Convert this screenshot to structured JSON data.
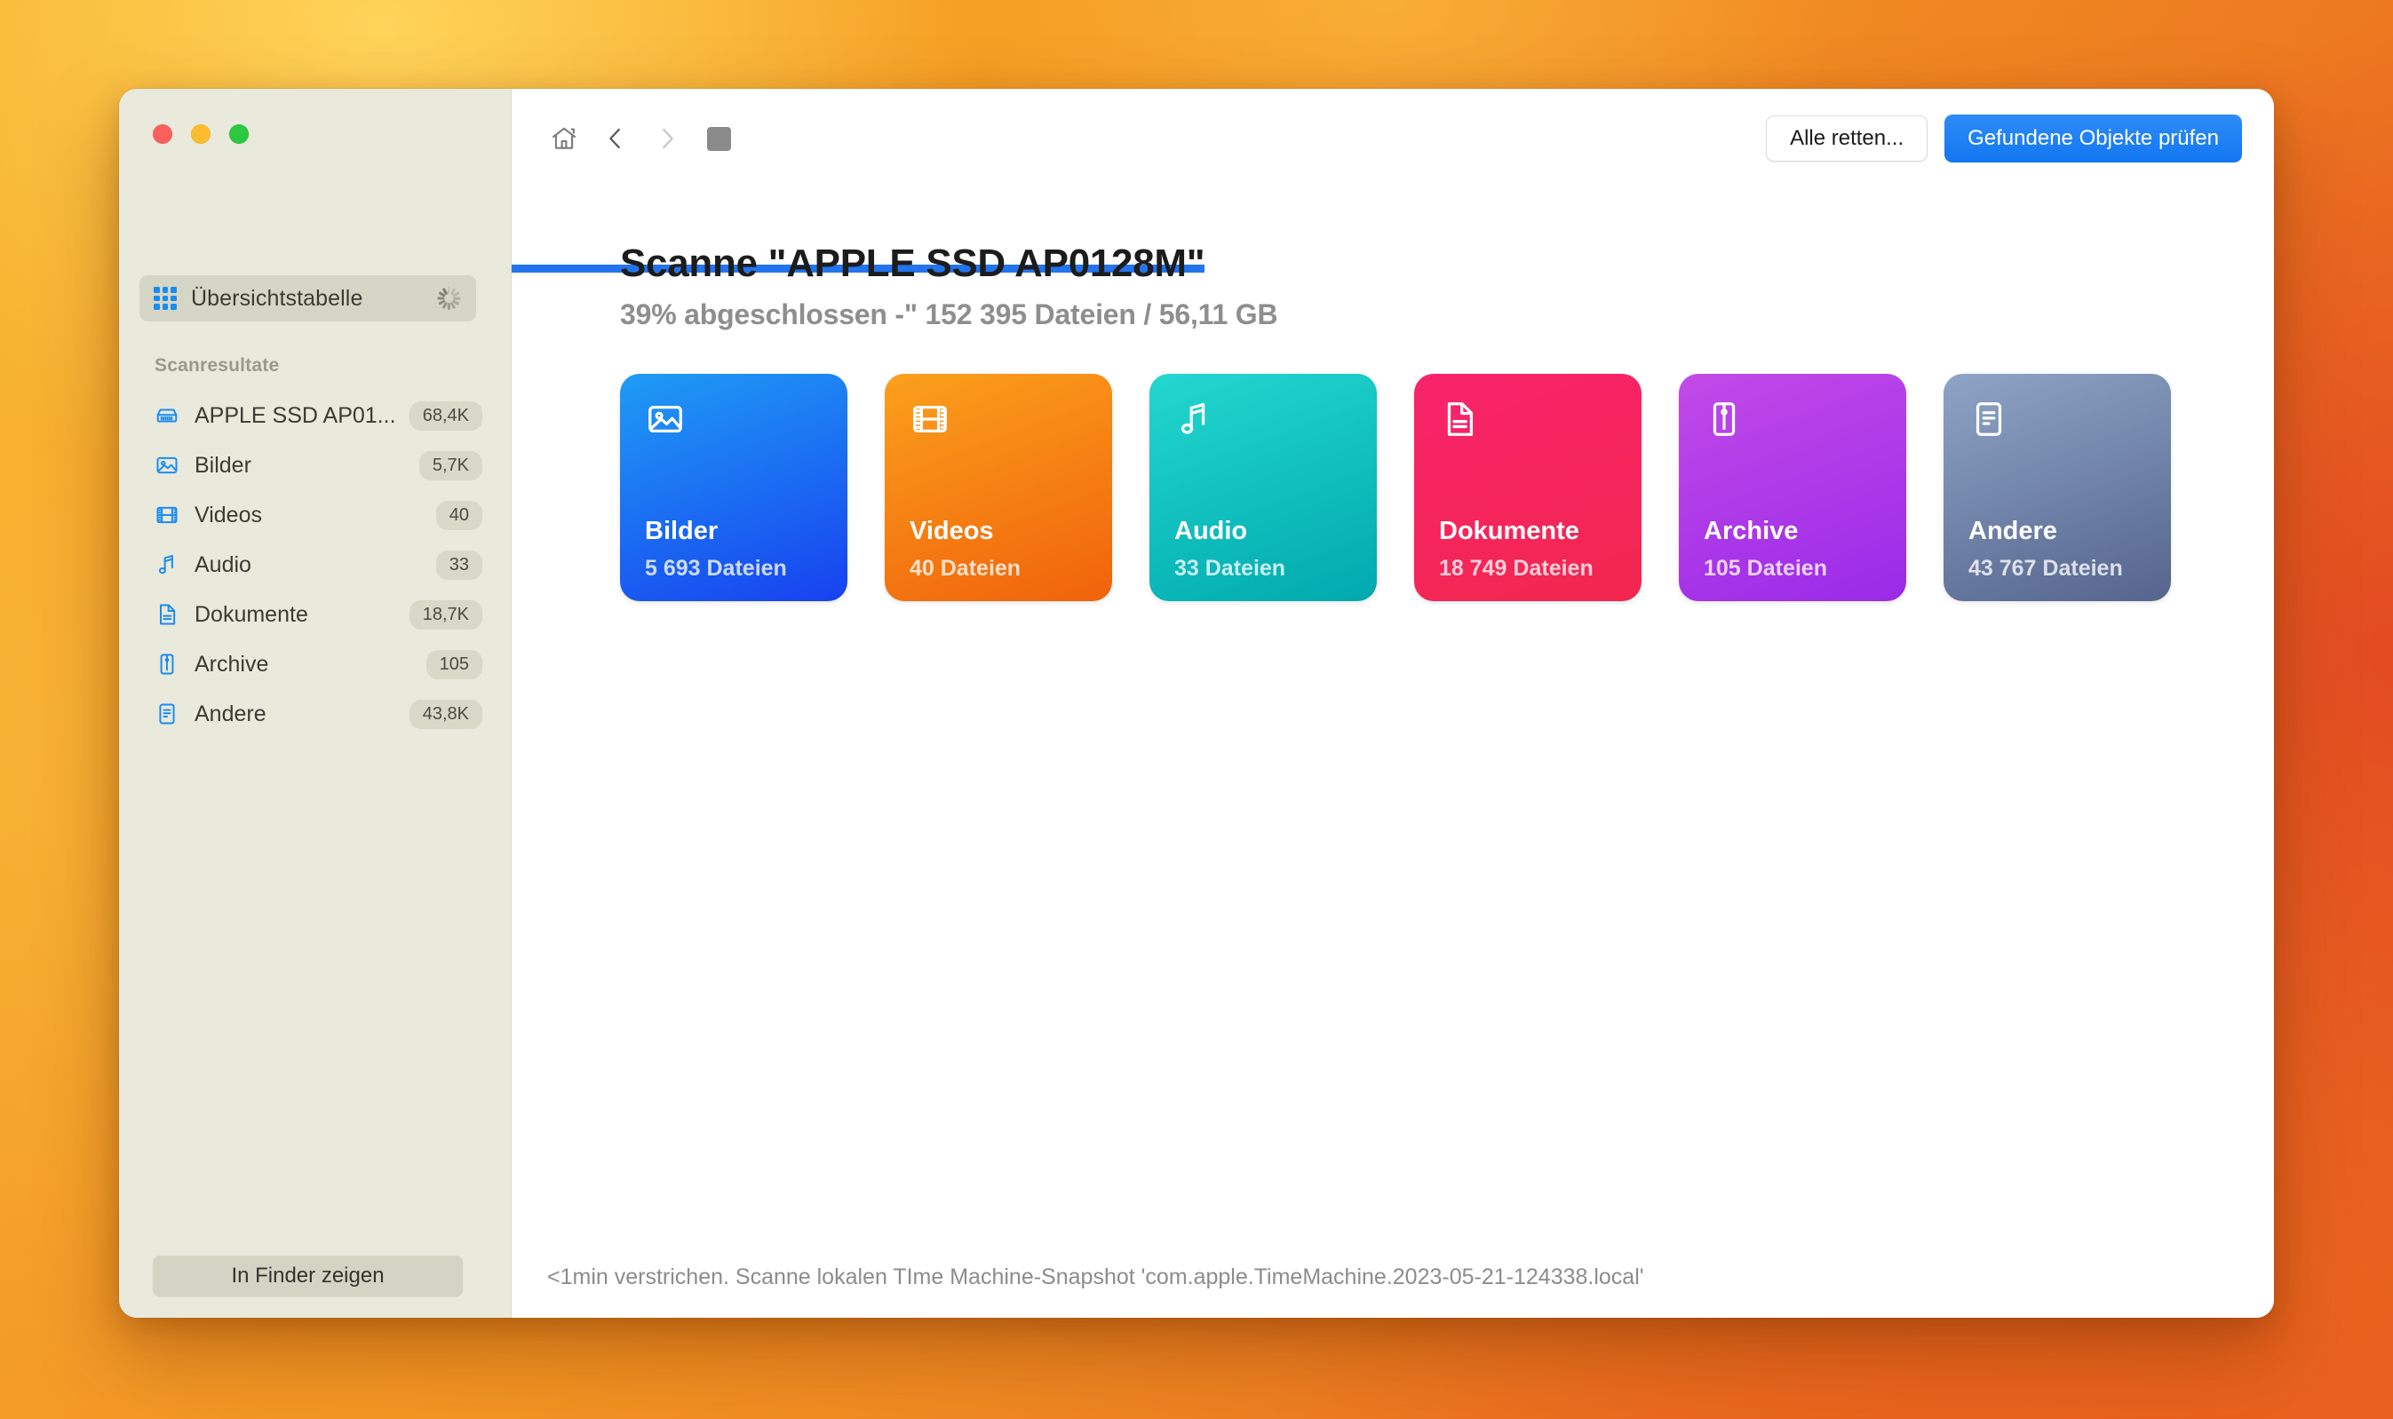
{
  "window": {
    "traffic_lights": [
      "close",
      "minimize",
      "zoom"
    ],
    "sidebar": {
      "overview": {
        "label": "Übersichtstabelle",
        "icon": "grid-icon",
        "busy": true
      },
      "section_heading": "Scanresultate",
      "items": [
        {
          "label": "APPLE SSD AP01...",
          "badge": "68,4K",
          "icon": "harddisk-icon"
        },
        {
          "label": "Bilder",
          "badge": "5,7K",
          "icon": "photo-icon"
        },
        {
          "label": "Videos",
          "badge": "40",
          "icon": "film-icon"
        },
        {
          "label": "Audio",
          "badge": "33",
          "icon": "music-note-icon"
        },
        {
          "label": "Dokumente",
          "badge": "18,7K",
          "icon": "document-icon"
        },
        {
          "label": "Archive",
          "badge": "105",
          "icon": "zip-icon"
        },
        {
          "label": "Andere",
          "badge": "43,8K",
          "icon": "note-icon"
        }
      ],
      "finder_button": "In Finder zeigen"
    },
    "toolbar": {
      "home_icon": "home-icon",
      "back_icon": "chevron-left-icon",
      "forward_icon": "chevron-right-icon",
      "stop_icon": "stop-square-icon",
      "rescue_button": "Alle retten...",
      "check_button": "Gefundene Objekte prüfen"
    },
    "progress": {
      "percent": 39,
      "accent_color": "#2374ef"
    },
    "main": {
      "title": "Scanne \"APPLE SSD AP0128M\"",
      "subtitle": "39% abgeschlossen -\" 152 395 Dateien / 56,11 GB",
      "cards": [
        {
          "title": "Bilder",
          "subtitle": "5 693 Dateien",
          "icon": "photo-icon",
          "color_from": "#1f9cf5",
          "color_to": "#1741ef"
        },
        {
          "title": "Videos",
          "subtitle": "40 Dateien",
          "icon": "film-icon",
          "color_from": "#fba01c",
          "color_to": "#f0620b"
        },
        {
          "title": "Audio",
          "subtitle": "33 Dateien",
          "icon": "music-note-icon",
          "color_from": "#23d7cf",
          "color_to": "#00a9ae"
        },
        {
          "title": "Dokumente",
          "subtitle": "18 749 Dateien",
          "icon": "document-icon",
          "color_from": "#f8246c",
          "color_to": "#f2264e"
        },
        {
          "title": "Archive",
          "subtitle": "105 Dateien",
          "icon": "zip-icon",
          "color_from": "#c24ae8",
          "color_to": "#9a2ae8"
        },
        {
          "title": "Andere",
          "subtitle": "43 767 Dateien",
          "icon": "note-icon",
          "color_from": "#8ea4c6",
          "color_to": "#55648c"
        }
      ]
    },
    "statusbar": {
      "text": "<1min verstrichen. Scanne lokalen TIme Machine-Snapshot 'com.apple.TimeMachine.2023-05-21-124338.local'"
    }
  }
}
